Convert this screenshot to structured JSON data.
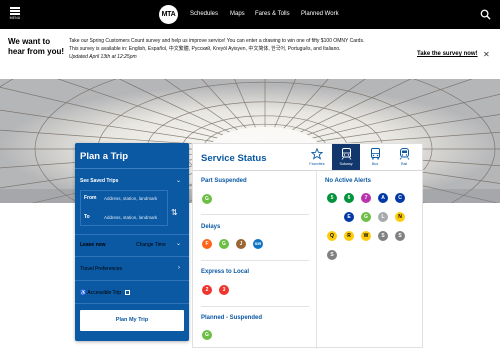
{
  "nav": {
    "menu_label": "MENU",
    "logo": "MTA",
    "links": [
      "Schedules",
      "Maps",
      "Fares & Tolls",
      "Planned Work"
    ]
  },
  "banner": {
    "title": "We want to hear from you!",
    "text": "Take our Spring Customers Count survey and help us improve service! You can enter a drawing to win one of fifty $100 OMNY Cards. This survey is available in: English, Español, 中文繁體, Русский, Kreyòl Ayisyen, 中文简体, 한국어, Português, and Italiano.",
    "updated": "Updated April 13th at 12:25pm",
    "link": "Take the survey now!"
  },
  "trip": {
    "title": "Plan a Trip",
    "saved": "See Saved Trips",
    "from_label": "From",
    "from_placeholder": "Address, station, landmark",
    "to_label": "To",
    "to_placeholder": "Address, station, landmark",
    "leave": "Leave now",
    "change_time": "Change Time",
    "preferences": "Travel Preferences",
    "accessible": "Accessible Trip",
    "button": "Plan My Trip"
  },
  "status": {
    "title": "Service Status",
    "modes": [
      "Favorites",
      "Subway",
      "Bus",
      "Rail"
    ],
    "active_mode": "Subway",
    "no_alerts": "No Active Alerts",
    "categories": [
      {
        "name": "Part Suspended",
        "lines": [
          "G"
        ]
      },
      {
        "name": "Delays",
        "lines": [
          "F",
          "G",
          "J",
          "SIR"
        ]
      },
      {
        "name": "Express to Local",
        "lines": [
          "2",
          "3"
        ]
      },
      {
        "name": "Planned - Suspended",
        "lines": [
          "G"
        ]
      }
    ],
    "good_lines": [
      "5",
      "6",
      "7",
      "A",
      "C",
      "E",
      "G",
      "L",
      "N",
      "Q",
      "R",
      "W",
      "S",
      "S",
      "S"
    ]
  },
  "colors": {
    "brand_blue": "#0b59a3",
    "dark_blue": "#11376d",
    "line_123": "#ee352e",
    "line_456": "#00933c",
    "line_7": "#b933ad",
    "line_ace": "#0039a6",
    "line_bdfm": "#ff6319",
    "line_g": "#6cbe45",
    "line_jz": "#996633",
    "line_l": "#a7a9ac",
    "line_nqrw": "#fccc0a",
    "line_s": "#808183",
    "line_sir": "#0f74c2"
  }
}
